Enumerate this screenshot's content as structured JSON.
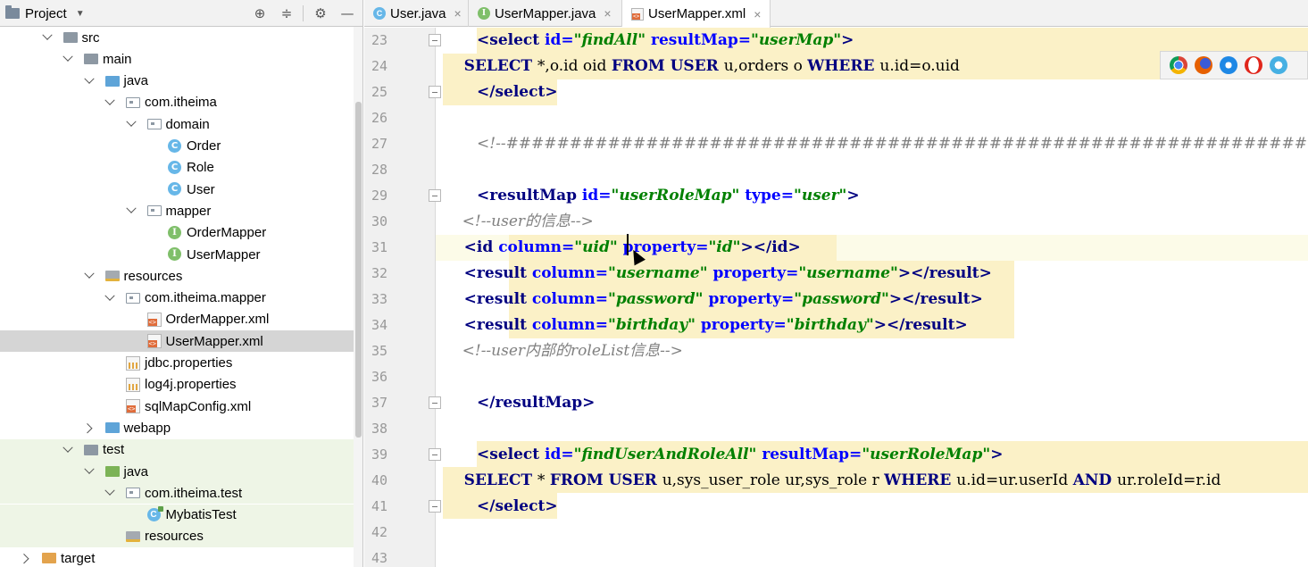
{
  "project_panel": {
    "title": "Project",
    "tools": [
      "locate-icon",
      "collapse-icon",
      "gear-icon",
      "hide-icon"
    ],
    "tree": [
      {
        "label": "src",
        "icon": "folder-icon",
        "expanded": true
      },
      {
        "label": "main",
        "icon": "folder-icon",
        "expanded": true
      },
      {
        "label": "java",
        "icon": "source-folder-icon",
        "expanded": true
      },
      {
        "label": "com.itheima",
        "icon": "package-icon",
        "expanded": true
      },
      {
        "label": "domain",
        "icon": "package-icon",
        "expanded": true
      },
      {
        "label": "Order",
        "icon": "class-icon"
      },
      {
        "label": "Role",
        "icon": "class-icon"
      },
      {
        "label": "User",
        "icon": "class-icon"
      },
      {
        "label": "mapper",
        "icon": "package-icon",
        "expanded": true
      },
      {
        "label": "OrderMapper",
        "icon": "interface-icon"
      },
      {
        "label": "UserMapper",
        "icon": "interface-icon"
      },
      {
        "label": "resources",
        "icon": "resources-folder-icon",
        "expanded": true
      },
      {
        "label": "com.itheima.mapper",
        "icon": "package-icon",
        "expanded": true
      },
      {
        "label": "OrderMapper.xml",
        "icon": "xml-file-icon"
      },
      {
        "label": "UserMapper.xml",
        "icon": "xml-file-icon",
        "selected": true
      },
      {
        "label": "jdbc.properties",
        "icon": "properties-file-icon"
      },
      {
        "label": "log4j.properties",
        "icon": "properties-file-icon"
      },
      {
        "label": "sqlMapConfig.xml",
        "icon": "xml-file-icon"
      },
      {
        "label": "webapp",
        "icon": "web-folder-icon",
        "expanded": false
      },
      {
        "label": "test",
        "icon": "folder-icon",
        "expanded": true
      },
      {
        "label": "java",
        "icon": "test-folder-icon",
        "expanded": true
      },
      {
        "label": "com.itheima.test",
        "icon": "package-icon",
        "expanded": true
      },
      {
        "label": "MybatisTest",
        "icon": "test-class-icon"
      },
      {
        "label": "resources",
        "icon": "resources-folder-icon"
      },
      {
        "label": "target",
        "icon": "excluded-folder-icon",
        "expanded": false
      }
    ]
  },
  "tabs": [
    {
      "label": "User.java",
      "icon": "class-icon",
      "active": false
    },
    {
      "label": "UserMapper.java",
      "icon": "interface-icon",
      "active": false
    },
    {
      "label": "UserMapper.xml",
      "icon": "xml-file-icon",
      "active": true
    }
  ],
  "tab_close_glyph": "×",
  "editor": {
    "line_numbers": [
      "23",
      "24",
      "25",
      "26",
      "27",
      "28",
      "29",
      "30",
      "31",
      "32",
      "33",
      "34",
      "35",
      "36",
      "37",
      "38",
      "39",
      "40",
      "41",
      "42",
      "43"
    ],
    "current_line": "31",
    "lines": [
      {
        "n": "23",
        "parts": [
          [
            "tag",
            "<select "
          ],
          [
            "attr",
            "id="
          ],
          [
            "str",
            "\"findAll\""
          ],
          [
            "attr",
            " resultMap="
          ],
          [
            "str",
            "\"userMap\""
          ],
          [
            "tag",
            ">"
          ]
        ]
      },
      {
        "n": "24",
        "parts": [
          [
            "sqlk",
            "    SELECT "
          ],
          [
            "sql",
            "*,o.id oid "
          ],
          [
            "sqlk",
            "FROM USER "
          ],
          [
            "sql",
            "u,orders o "
          ],
          [
            "sqlk",
            "WHERE "
          ],
          [
            "sql",
            "u.id=o.uid"
          ]
        ]
      },
      {
        "n": "25",
        "parts": [
          [
            "tag",
            "</select>"
          ]
        ]
      },
      {
        "n": "26",
        "parts": []
      },
      {
        "n": "27",
        "parts": [
          [
            "com",
            "<!--################################################################################-->"
          ]
        ]
      },
      {
        "n": "28",
        "parts": []
      },
      {
        "n": "29",
        "parts": [
          [
            "tag",
            "<resultMap "
          ],
          [
            "attr",
            "id="
          ],
          [
            "str",
            "\"userRoleMap\""
          ],
          [
            "attr",
            " type="
          ],
          [
            "str",
            "\"user\""
          ],
          [
            "tag",
            ">"
          ]
        ]
      },
      {
        "n": "30",
        "parts": [
          [
            "com",
            "    <!--user的信息-->"
          ]
        ]
      },
      {
        "n": "31",
        "parts": [
          [
            "tag",
            "    <id "
          ],
          [
            "attr",
            "column="
          ],
          [
            "str",
            "\"uid\""
          ],
          [
            "attr",
            " property="
          ],
          [
            "str",
            "\"id\""
          ],
          [
            "tag",
            "></id>"
          ]
        ]
      },
      {
        "n": "32",
        "parts": [
          [
            "tag",
            "    <result "
          ],
          [
            "attr",
            "column="
          ],
          [
            "str",
            "\"username\""
          ],
          [
            "attr",
            " property="
          ],
          [
            "str",
            "\"username\""
          ],
          [
            "tag",
            "></result>"
          ]
        ]
      },
      {
        "n": "33",
        "parts": [
          [
            "tag",
            "    <result "
          ],
          [
            "attr",
            "column="
          ],
          [
            "str",
            "\"password\""
          ],
          [
            "attr",
            " property="
          ],
          [
            "str",
            "\"password\""
          ],
          [
            "tag",
            "></result>"
          ]
        ]
      },
      {
        "n": "34",
        "parts": [
          [
            "tag",
            "    <result "
          ],
          [
            "attr",
            "column="
          ],
          [
            "str",
            "\"birthday\""
          ],
          [
            "attr",
            " property="
          ],
          [
            "str",
            "\"birthday\""
          ],
          [
            "tag",
            "></result>"
          ]
        ]
      },
      {
        "n": "35",
        "parts": [
          [
            "com",
            "    <!--user内部的roleList信息-->"
          ]
        ]
      },
      {
        "n": "36",
        "parts": []
      },
      {
        "n": "37",
        "parts": [
          [
            "tag",
            "</resultMap>"
          ]
        ]
      },
      {
        "n": "38",
        "parts": []
      },
      {
        "n": "39",
        "parts": [
          [
            "tag",
            "<select "
          ],
          [
            "attr",
            "id="
          ],
          [
            "str",
            "\"findUserAndRoleAll\""
          ],
          [
            "attr",
            " resultMap="
          ],
          [
            "str",
            "\"userRoleMap\""
          ],
          [
            "tag",
            ">"
          ]
        ]
      },
      {
        "n": "40",
        "parts": [
          [
            "sqlk",
            "    SELECT "
          ],
          [
            "sql",
            "* "
          ],
          [
            "sqlk",
            "FROM USER "
          ],
          [
            "sql",
            "u,sys_user_role ur,sys_role r "
          ],
          [
            "sqlk",
            "WHERE "
          ],
          [
            "sql",
            "u.id=ur.userId "
          ],
          [
            "sqlk",
            "AND "
          ],
          [
            "sql",
            "ur.roleId=r.id"
          ]
        ]
      },
      {
        "n": "41",
        "parts": [
          [
            "tag",
            "</select>"
          ]
        ]
      },
      {
        "n": "42",
        "parts": []
      },
      {
        "n": "43",
        "parts": []
      }
    ]
  },
  "browser_icons": [
    "chrome-icon",
    "firefox-icon",
    "safari-icon",
    "opera-icon",
    "ie-icon",
    "edge-icon"
  ],
  "colors": {
    "tag": "#000080",
    "attribute": "#0000ff",
    "string": "#008000",
    "comment": "#808080",
    "selection_highlight": "#fbf1c7",
    "selected_row": "#d5d5d5"
  }
}
